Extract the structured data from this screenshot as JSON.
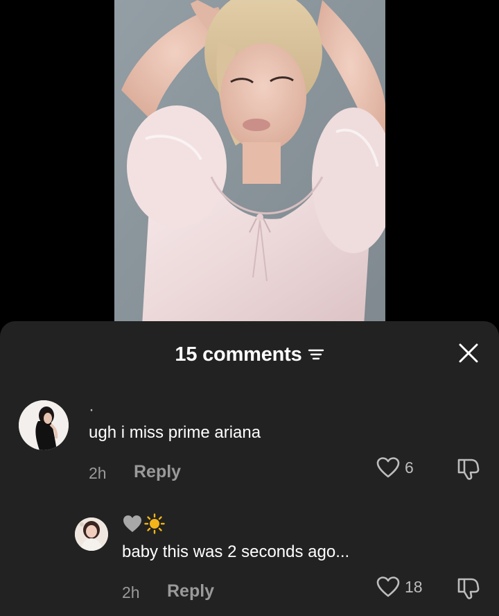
{
  "video": {
    "subject_icon": "photo-of-woman-in-pink-puff-sleeve-dress"
  },
  "comments_sheet": {
    "title": "15 comments",
    "filter_icon": "filter-icon",
    "close_icon": "close-icon",
    "colors": {
      "sheet_background": "#222222",
      "primary_text": "#ffffff",
      "secondary_text": "#9a9a9a"
    }
  },
  "comments": [
    {
      "username": "·",
      "text": "ugh i miss prime ariana",
      "timestamp": "2h",
      "reply_label": "Reply",
      "like_count": "6",
      "like_icon": "heart-outline-icon",
      "dislike_icon": "thumbs-down-icon"
    },
    {
      "username_icons": [
        "gray-heart-icon",
        "sun-icon"
      ],
      "text": "baby this was 2 seconds ago...",
      "timestamp": "2h",
      "reply_label": "Reply",
      "like_count": "18",
      "like_icon": "heart-outline-icon",
      "dislike_icon": "thumbs-down-icon"
    }
  ]
}
